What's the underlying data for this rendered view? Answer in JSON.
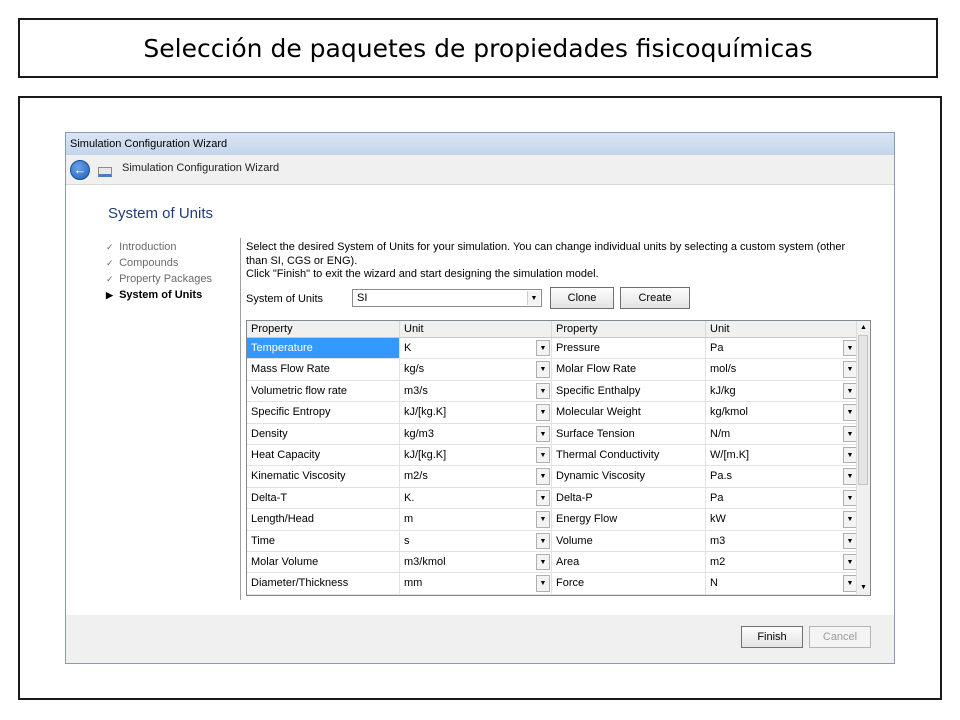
{
  "slide": {
    "title": "Selección de paquetes de propiedades fisicoquímicas"
  },
  "window": {
    "title": "Simulation Configuration Wizard"
  },
  "navbar": {
    "title": "Simulation Configuration Wizard",
    "back_icon": "back-arrow-icon"
  },
  "page": {
    "heading": "System of Units",
    "steps": [
      {
        "label": "Introduction",
        "marker": "✓",
        "state": "done"
      },
      {
        "label": "Compounds",
        "marker": "✓",
        "state": "done"
      },
      {
        "label": "Property Packages",
        "marker": "✓",
        "state": "done"
      },
      {
        "label": "System of Units",
        "marker": "▶",
        "state": "current"
      }
    ],
    "description_line1": "Select the desired System of Units for your simulation. You can change individual units by selecting a custom system (other than SI, CGS or ENG).",
    "description_line2": "Click \"Finish\" to exit the wizard and start designing the simulation model.",
    "system_label": "System of Units",
    "system_value": "SI",
    "clone_label": "Clone",
    "create_label": "Create"
  },
  "grid": {
    "headers": [
      "Property",
      "Unit",
      "Property",
      "Unit"
    ],
    "selected_color": "#3399ff",
    "rows": [
      [
        "Temperature",
        "K",
        "Pressure",
        "Pa"
      ],
      [
        "Mass Flow Rate",
        "kg/s",
        "Molar Flow Rate",
        "mol/s"
      ],
      [
        "Volumetric flow rate",
        "m3/s",
        "Specific Enthalpy",
        "kJ/kg"
      ],
      [
        "Specific Entropy",
        "kJ/[kg.K]",
        "Molecular Weight",
        "kg/kmol"
      ],
      [
        "Density",
        "kg/m3",
        "Surface Tension",
        "N/m"
      ],
      [
        "Heat Capacity",
        "kJ/[kg.K]",
        "Thermal Conductivity",
        "W/[m.K]"
      ],
      [
        "Kinematic Viscosity",
        "m2/s",
        "Dynamic Viscosity",
        "Pa.s"
      ],
      [
        "Delta-T",
        "K.",
        "Delta-P",
        "Pa"
      ],
      [
        "Length/Head",
        "m",
        "Energy Flow",
        "kW"
      ],
      [
        "Time",
        "s",
        "Volume",
        "m3"
      ],
      [
        "Molar Volume",
        "m3/kmol",
        "Area",
        "m2"
      ],
      [
        "Diameter/Thickness",
        "mm",
        "Force",
        "N"
      ]
    ]
  },
  "footer": {
    "finish_label": "Finish",
    "cancel_label": "Cancel"
  }
}
